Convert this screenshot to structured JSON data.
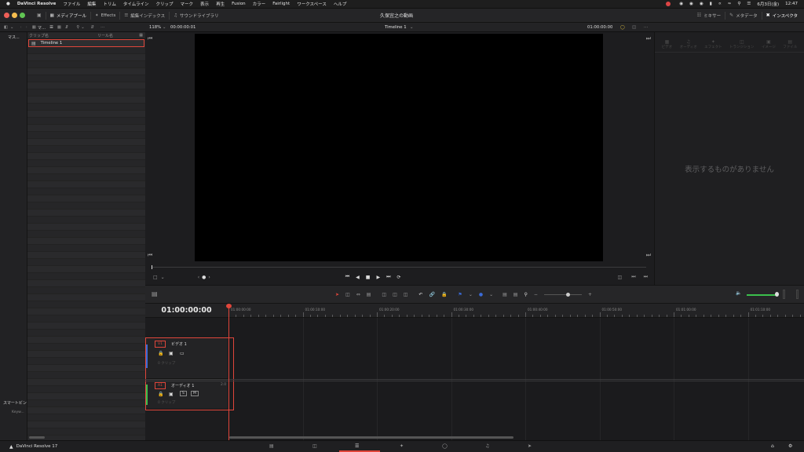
{
  "menubar": {
    "app": "DaVinci Resolve",
    "items": [
      "ファイル",
      "編集",
      "トリム",
      "タイムライン",
      "クリップ",
      "マーク",
      "表示",
      "再生",
      "Fusion",
      "カラー",
      "Fairlight",
      "ワークスペース",
      "ヘルプ"
    ],
    "datetime": "6月3日(金)",
    "time": "12:47"
  },
  "titlebar": {
    "media_pool": "メディアプール",
    "effects": "Effects",
    "edit_index": "編集インデックス",
    "sound_library": "サウンドライブラリ",
    "project": "久保宜之の動画",
    "mixer": "ミキサー",
    "metadata": "メタデータ",
    "inspector": "インスペクタ"
  },
  "toolbar2": {
    "master": "マ...",
    "zoom": "118%",
    "timecode": "00:00:00:01",
    "timeline_name": "Timeline 1",
    "timecode_right": "01:00:00:00"
  },
  "leftcol": {
    "master": "マス...",
    "smart_bins": "スマートビン",
    "keywords": "Keyw..."
  },
  "binlist": {
    "col_clip": "クリップ名",
    "col_reel": "リール名",
    "item": "Timeline 1"
  },
  "inspector": {
    "tabs": [
      "ビデオ",
      "オーディオ",
      "エフェクト",
      "トランジション",
      "イメージ",
      "ファイル"
    ],
    "empty": "表示するものがありません"
  },
  "timeline": {
    "timecode": "01:00:00:00",
    "ruler": [
      "01:00:00:00",
      "01:00:10:00",
      "01:00:20:00",
      "01:00:30:00",
      "01:00:40:00",
      "01:00:50:00",
      "01:01:00:00",
      "01:01:10:00"
    ],
    "v1": {
      "tag": "V1",
      "name": "ビデオ 1",
      "clips": "0 クリップ"
    },
    "a1": {
      "tag": "A1",
      "name": "オーディオ 1",
      "level": "2.0",
      "clips": "0 クリップ",
      "s": "S",
      "m": "M"
    }
  },
  "bottom": {
    "brand": "DaVinci Resolve 17"
  },
  "colors": {
    "accent": "#e0463b",
    "playhead": "#e0463b",
    "blue": "#3a6bd8",
    "green": "#3bbf4c"
  }
}
